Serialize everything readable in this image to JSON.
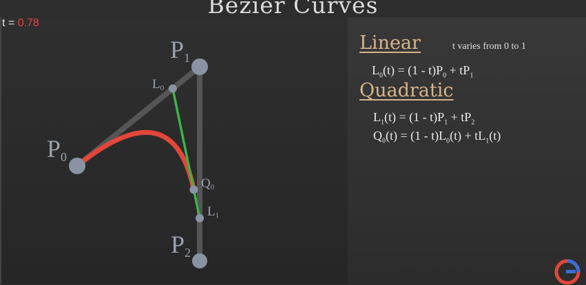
{
  "title": "Bezier Curves",
  "t_readout": {
    "label": "t = ",
    "value": "0.78",
    "t": 0.78
  },
  "colors": {
    "curve": "#e3463a",
    "interp_line": "#3db34a",
    "control_lines": "#555555",
    "points": "#8a93a3",
    "heading": "#d7b58b",
    "t_value": "#e3463a"
  },
  "points": {
    "P0": {
      "name": "P",
      "sub": "0"
    },
    "P1": {
      "name": "P",
      "sub": "1"
    },
    "P2": {
      "name": "P",
      "sub": "2"
    },
    "L0": {
      "name": "L",
      "sub": "0"
    },
    "L1": {
      "name": "L",
      "sub": "1"
    },
    "Q0": {
      "name": "Q",
      "sub": "0"
    }
  },
  "panel": {
    "linear": {
      "heading": "Linear",
      "note": "t varies from 0 to 1",
      "equation": {
        "lhs": "L",
        "lhs_sub": "0",
        "body1": "(t) = (1 - t)P",
        "sub1": "0",
        "body2": " + tP",
        "sub2": "1"
      }
    },
    "quadratic": {
      "heading": "Quadratic",
      "eq1": {
        "lhs": "L",
        "lhs_sub": "1",
        "body1": "(t) = (1 - t)P",
        "sub1": "1",
        "body2": " + tP",
        "sub2": "2"
      },
      "eq2": {
        "lhs": "Q",
        "lhs_sub": "0",
        "body1": "(t) = (1 - t)L",
        "sub1": "0",
        "body2": "(t) + tL",
        "sub2": "1",
        "tail": "(t)"
      }
    }
  },
  "logo_icon": "bezier-g-logo-icon"
}
